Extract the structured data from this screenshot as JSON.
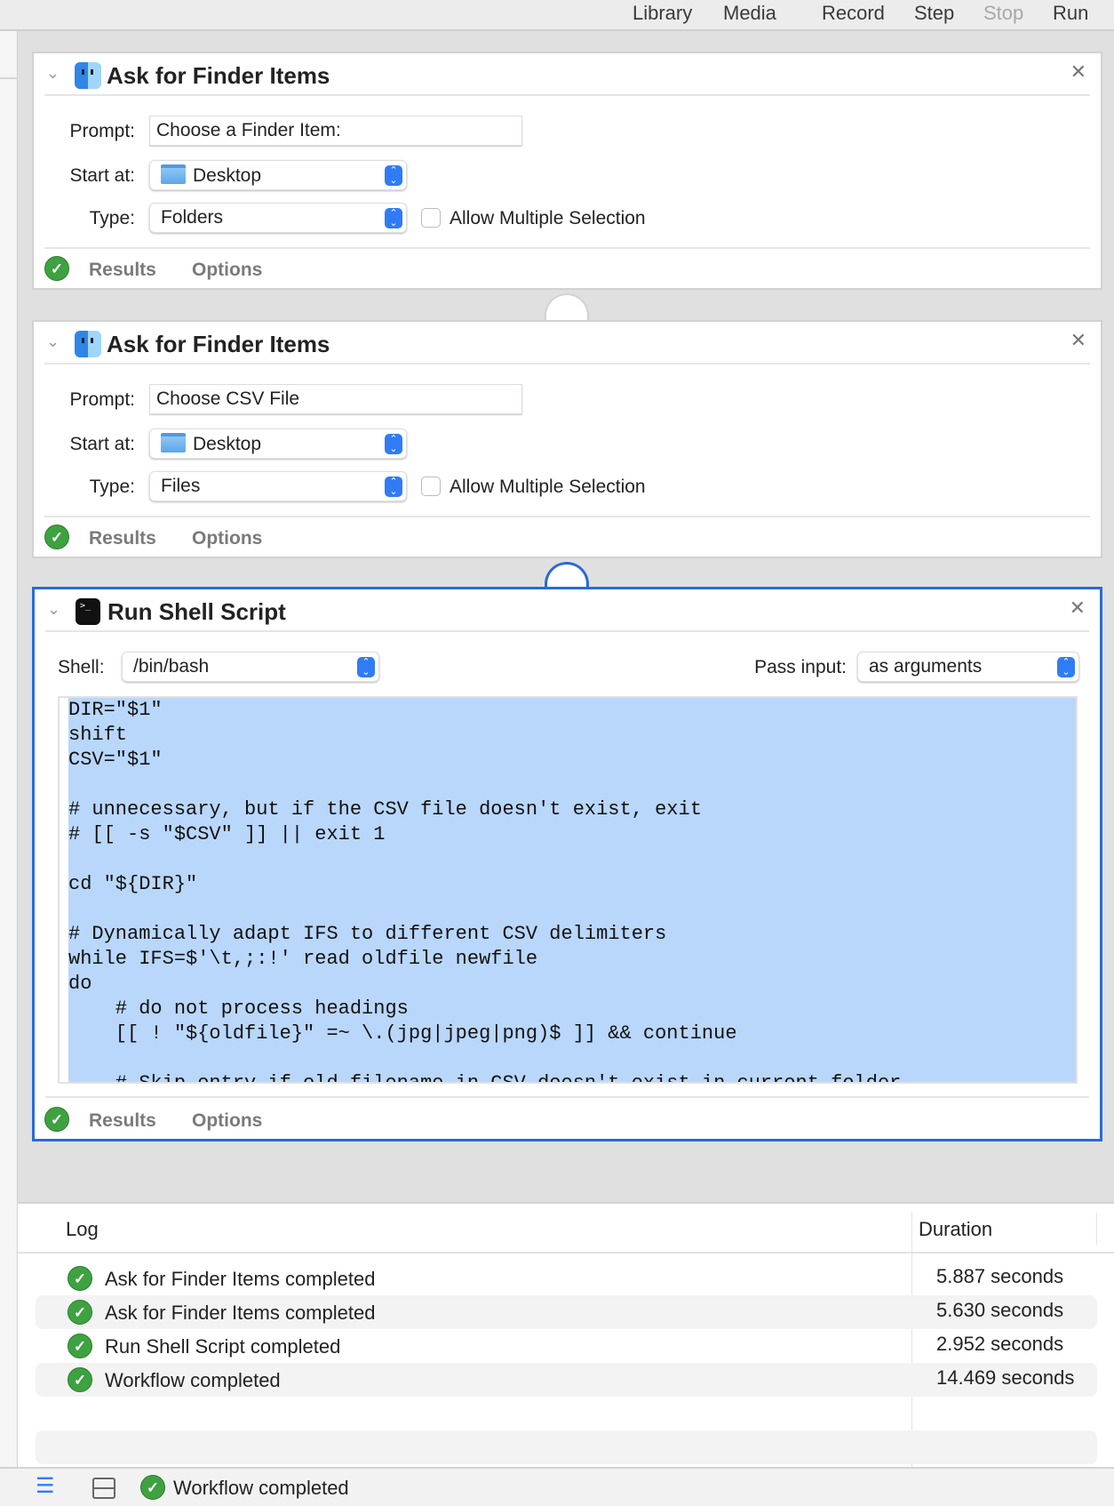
{
  "toolbar": {
    "library": "Library",
    "media": "Media",
    "record": "Record",
    "step": "Step",
    "stop": "Stop",
    "run": "Run"
  },
  "actions": [
    {
      "title": "Ask for Finder Items",
      "prompt_label": "Prompt:",
      "prompt": "Choose a Finder Item:",
      "start_label": "Start at:",
      "start": "Desktop",
      "type_label": "Type:",
      "type": "Folders",
      "allow_multiple": "Allow Multiple Selection",
      "allow_multiple_checked": false,
      "results": "Results",
      "options": "Options"
    },
    {
      "title": "Ask for Finder Items",
      "prompt_label": "Prompt:",
      "prompt": "Choose CSV File",
      "start_label": "Start at:",
      "start": "Desktop",
      "type_label": "Type:",
      "type": "Files",
      "allow_multiple": "Allow Multiple Selection",
      "allow_multiple_checked": false,
      "results": "Results",
      "options": "Options"
    },
    {
      "title": "Run Shell Script",
      "shell_label": "Shell:",
      "shell": "/bin/bash",
      "pass_label": "Pass input:",
      "pass": "as arguments",
      "script": "DIR=\"$1\"\nshift\nCSV=\"$1\"\n\n# unnecessary, but if the CSV file doesn't exist, exit\n# [[ -s \"$CSV\" ]] || exit 1\n\ncd \"${DIR}\"\n\n# Dynamically adapt IFS to different CSV delimiters\nwhile IFS=$'\\t,;:!' read oldfile newfile\ndo\n    # do not process headings\n    [[ ! \"${oldfile}\" =~ \\.(jpg|jpeg|png)$ ]] && continue\n\n    # Skip entry if old filename in CSV doesn't exist in current folder",
      "results": "Results",
      "options": "Options"
    }
  ],
  "log": {
    "col_log": "Log",
    "col_duration": "Duration",
    "rows": [
      {
        "msg": "Ask for Finder Items completed",
        "dur": "5.887 seconds"
      },
      {
        "msg": "Ask for Finder Items completed",
        "dur": "5.630 seconds"
      },
      {
        "msg": "Run Shell Script completed",
        "dur": "2.952 seconds"
      },
      {
        "msg": "Workflow completed",
        "dur": "14.469 seconds"
      }
    ]
  },
  "status": {
    "text": "Workflow completed"
  },
  "colors": {
    "accent": "#2a6ad8",
    "selection": "#b9d7fb",
    "success": "#3da23f"
  }
}
